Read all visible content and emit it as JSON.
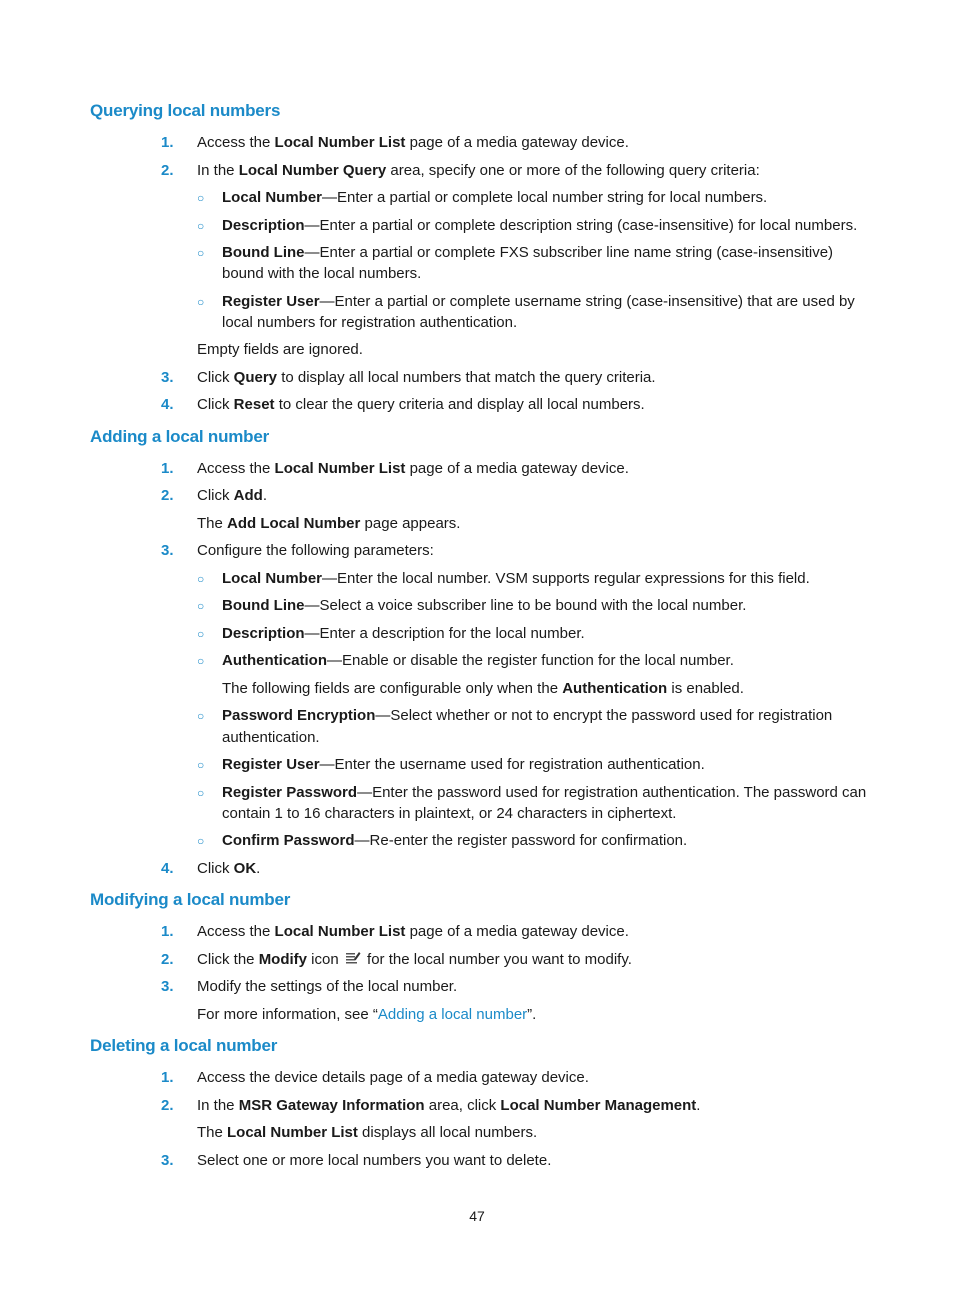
{
  "sections": {
    "querying": {
      "title": "Querying local numbers",
      "s1": {
        "num": "1.",
        "a": "Access the ",
        "b": "Local Number List",
        "c": " page of a media gateway device."
      },
      "s2": {
        "num": "2.",
        "a": "In the ",
        "b": "Local Number Query",
        "c": " area, specify one or more of the following query criteria:"
      },
      "bul1": {
        "b": "Local Number",
        "c": "—Enter a partial or complete local number string for local numbers."
      },
      "bul2": {
        "b": "Description",
        "c": "—Enter a partial or complete description string (case-insensitive) for local numbers."
      },
      "bul3": {
        "b": "Bound Line",
        "c": "—Enter a partial or complete FXS subscriber line name string (case-insensitive)",
        "c2": "bound with the local numbers."
      },
      "bul4": {
        "b": "Register User",
        "c": "—Enter a partial or complete username string (case-insensitive) that are used by",
        "c2": "local numbers for registration authentication."
      },
      "note": "Empty fields are ignored.",
      "s3": {
        "num": "3.",
        "a": "Click ",
        "b": "Query",
        "c": " to display all local numbers that match the query criteria."
      },
      "s4": {
        "num": "4.",
        "a": "Click ",
        "b": "Reset",
        "c": " to clear the query criteria and display all local numbers."
      }
    },
    "adding": {
      "title": "Adding a local number",
      "s1": {
        "num": "1.",
        "a": "Access the ",
        "b": "Local Number List",
        "c": " page of a media gateway device."
      },
      "s2": {
        "num": "2.",
        "a": "Click ",
        "b": "Add",
        "c": "."
      },
      "s2note": {
        "a": "The ",
        "b": "Add Local Number",
        "c": " page appears."
      },
      "s3": {
        "num": "3.",
        "a": "Configure the following parameters:"
      },
      "bul1": {
        "b": "Local Number",
        "c": "—Enter the local number. VSM supports regular expressions for this field."
      },
      "bul2": {
        "b": "Bound Line",
        "c": "—Select a voice subscriber line to be bound with the local number."
      },
      "bul3": {
        "b": "Description",
        "c": "—Enter a description for the local number."
      },
      "bul4": {
        "b": "Authentication",
        "c": "—Enable or disable the register function for the local number."
      },
      "authnote": {
        "a": "The following fields are configurable only when the ",
        "b": "Authentication",
        "c": " is enabled."
      },
      "bul5": {
        "b": "Password Encryption",
        "c": "—Select whether or not to encrypt the password used for registration",
        "c2": "authentication."
      },
      "bul6": {
        "b": "Register User",
        "c": "—Enter the username used for registration authentication."
      },
      "bul7": {
        "b": "Register Password",
        "c": "—Enter the password used for registration authentication. The password can",
        "c2": "contain 1 to 16 characters in plaintext, or 24 characters in ciphertext."
      },
      "bul8": {
        "b": "Confirm Password",
        "c": "—Re-enter the register password for confirmation."
      },
      "s4": {
        "num": "4.",
        "a": "Click ",
        "b": "OK",
        "c": "."
      }
    },
    "modifying": {
      "title": "Modifying a local number",
      "s1": {
        "num": "1.",
        "a": "Access the ",
        "b": "Local Number List",
        "c": " page of a media gateway device."
      },
      "s2": {
        "num": "2.",
        "a": "Click the ",
        "b": "Modify",
        "c": " icon ",
        "d": " for the local number you want to modify.",
        "icon": "modify-icon"
      },
      "s3": {
        "num": "3.",
        "a": "Modify the settings of the local number."
      },
      "note": {
        "a": "For more information, see “",
        "link": "Adding a local number",
        "c": "”."
      }
    },
    "deleting": {
      "title": "Deleting a local number",
      "s1": {
        "num": "1.",
        "a": "Access the device details page of a media gateway device."
      },
      "s2": {
        "num": "2.",
        "a": "In the ",
        "b": "MSR Gateway Information",
        "c": " area, click ",
        "d": "Local Number Management",
        "e": "."
      },
      "s2note": {
        "a": "The ",
        "b": "Local Number List",
        "c": " displays all local numbers."
      },
      "s3": {
        "num": "3.",
        "a": "Select one or more local numbers you want to delete."
      }
    }
  },
  "bullet_glyph": "○",
  "page_number": "47"
}
